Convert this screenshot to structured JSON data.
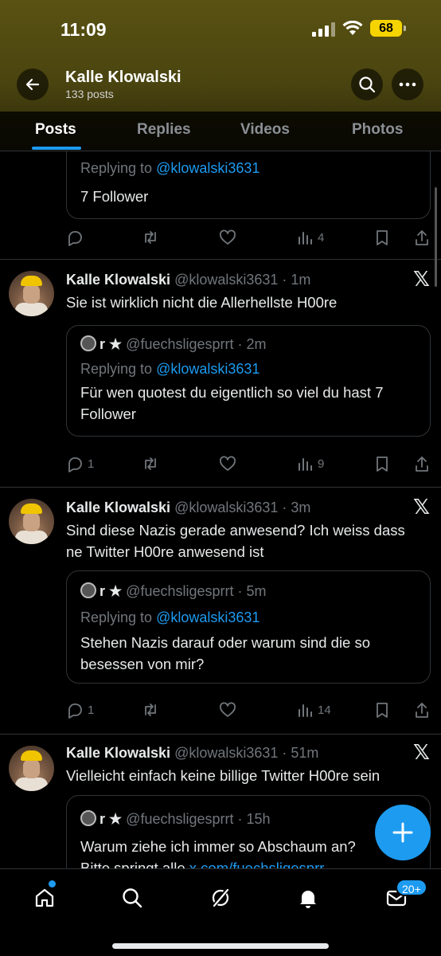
{
  "status_bar": {
    "time": "11:09",
    "battery": "68"
  },
  "profile_header": {
    "name": "Kalle Klowalski",
    "post_count": "133 posts"
  },
  "tabs": [
    {
      "label": "Posts",
      "active": true
    },
    {
      "label": "Replies",
      "active": false
    },
    {
      "label": "Videos",
      "active": false
    },
    {
      "label": "Photos",
      "active": false
    }
  ],
  "posts": [
    {
      "quote": {
        "replying_prefix": "Replying to ",
        "replying_handle": "@klowalski3631",
        "text": "7 Follower"
      },
      "stats": {
        "replies": "",
        "views": "4"
      }
    },
    {
      "author_name": "Kalle Klowalski",
      "author_meta": "@klowalski3631 · 1m",
      "text": "Sie ist wirklich nicht die Allerhellste H00re",
      "quote": {
        "author_name": "r ★",
        "author_meta": "@fuechsligesprrt · 2m",
        "replying_prefix": "Replying to ",
        "replying_handle": "@klowalski3631",
        "text": "Für wen quotest du eigentlich so viel du hast 7 Follower"
      },
      "stats": {
        "replies": "1",
        "views": "9"
      }
    },
    {
      "author_name": "Kalle Klowalski",
      "author_meta": "@klowalski3631 · 3m",
      "text": "Sind diese Nazis gerade anwesend? Ich weiss dass ne Twitter H00re anwesend ist",
      "quote": {
        "author_name": "r ★",
        "author_meta": "@fuechsligesprrt · 5m",
        "replying_prefix": "Replying to ",
        "replying_handle": "@klowalski3631",
        "text": "Stehen Nazis darauf oder warum sind die so besessen von mir?"
      },
      "stats": {
        "replies": "1",
        "views": "14"
      }
    },
    {
      "author_name": "Kalle Klowalski",
      "author_meta": "@klowalski3631 · 51m",
      "text": "Vielleicht einfach keine billige Twitter H00re sein",
      "quote": {
        "author_name": "r ★",
        "author_meta": "@fuechsligesprrt · 15h",
        "text_line1": "Warum ziehe ich immer so Abschaum an?",
        "text_line2_prefix": "Bitte springt alle ",
        "text_line2_link": "x.com/fuechsligesprr"
      }
    }
  ],
  "bottom_nav": {
    "notifications_badge": "20+"
  },
  "colors": {
    "accent": "#1d9bf0",
    "background": "#000000",
    "muted": "#71767b",
    "header_tint": "#4a4410"
  }
}
